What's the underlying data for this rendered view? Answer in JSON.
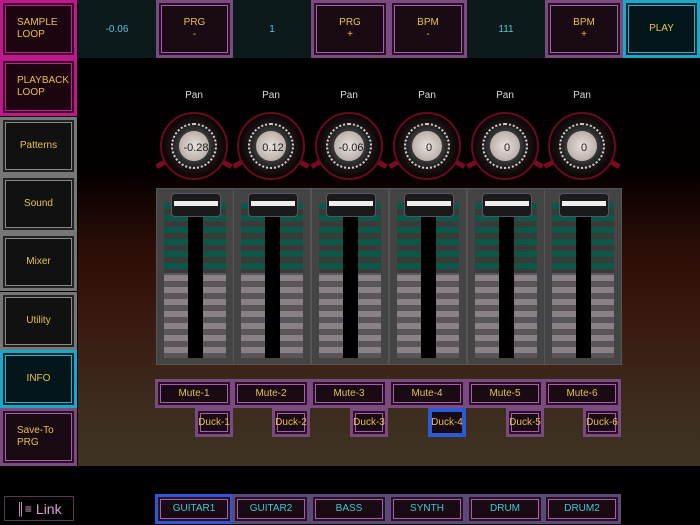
{
  "left_nav": [
    {
      "label": "SAMPLE LOOP",
      "style": "mag"
    },
    {
      "label": "PLAYBACK LOOP",
      "style": "mag"
    },
    {
      "label": "Patterns",
      "style": "grey"
    },
    {
      "label": "Sound",
      "style": "grey"
    },
    {
      "label": "Mixer",
      "style": "grey"
    },
    {
      "label": "Utility",
      "style": "grey"
    },
    {
      "label": "INFO",
      "style": "cyan"
    },
    {
      "label": "Save-To PRG",
      "style": ""
    }
  ],
  "top": {
    "value": "-0.06",
    "prg_minus": "PRG\n-",
    "program": "1",
    "prg_plus": "PRG\n+",
    "bpm_minus": "BPM\n-",
    "bpm": "111",
    "bpm_plus": "BPM\n+",
    "play": "PLAY"
  },
  "channels": [
    {
      "pan_label": "Pan",
      "pan": "-0.28",
      "mute": "Mute-1",
      "duck": "Duck-1"
    },
    {
      "pan_label": "Pan",
      "pan": "0.12",
      "mute": "Mute-2",
      "duck": "Duck-2"
    },
    {
      "pan_label": "Pan",
      "pan": "-0.06",
      "mute": "Mute-3",
      "duck": "Duck-3"
    },
    {
      "pan_label": "Pan",
      "pan": "0",
      "mute": "Mute-4",
      "duck": "Duck-4"
    },
    {
      "pan_label": "Pan",
      "pan": "0",
      "mute": "Mute-5",
      "duck": "Duck-5"
    },
    {
      "pan_label": "Pan",
      "pan": "0",
      "mute": "Mute-6",
      "duck": "Duck-6"
    }
  ],
  "selected_duck": 3,
  "tracks": [
    "GUITAR1",
    "GUITAR2",
    "BASS",
    "SYNTH",
    "DRUM",
    "DRUM2"
  ],
  "selected_track": 0,
  "link_label": "Link"
}
